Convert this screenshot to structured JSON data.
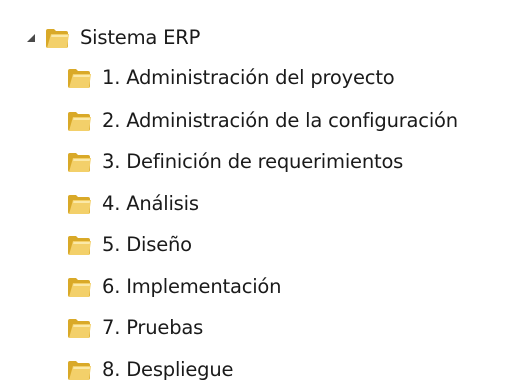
{
  "tree": {
    "root": {
      "label": "Sistema ERP",
      "expanded": true,
      "icon": "folder-icon",
      "expander_icon": "expanded-triangle-icon"
    },
    "children": [
      {
        "label": "1. Administración del proyecto",
        "icon": "folder-icon"
      },
      {
        "label": "2. Administración de la configuración",
        "icon": "folder-icon"
      },
      {
        "label": "3. Definición de requerimientos",
        "icon": "folder-icon"
      },
      {
        "label": "4. Análisis",
        "icon": "folder-icon"
      },
      {
        "label": "5. Diseño",
        "icon": "folder-icon"
      },
      {
        "label": "6. Implementación",
        "icon": "folder-icon"
      },
      {
        "label": "7. Pruebas",
        "icon": "folder-icon"
      },
      {
        "label": "8. Despliegue",
        "icon": "folder-icon"
      }
    ]
  },
  "colors": {
    "folder_back": "#d9a928",
    "folder_front": "#f3d06a",
    "folder_highlight": "#fbe9a8",
    "text": "#1a1a1a",
    "expander": "#4a4a4a"
  }
}
